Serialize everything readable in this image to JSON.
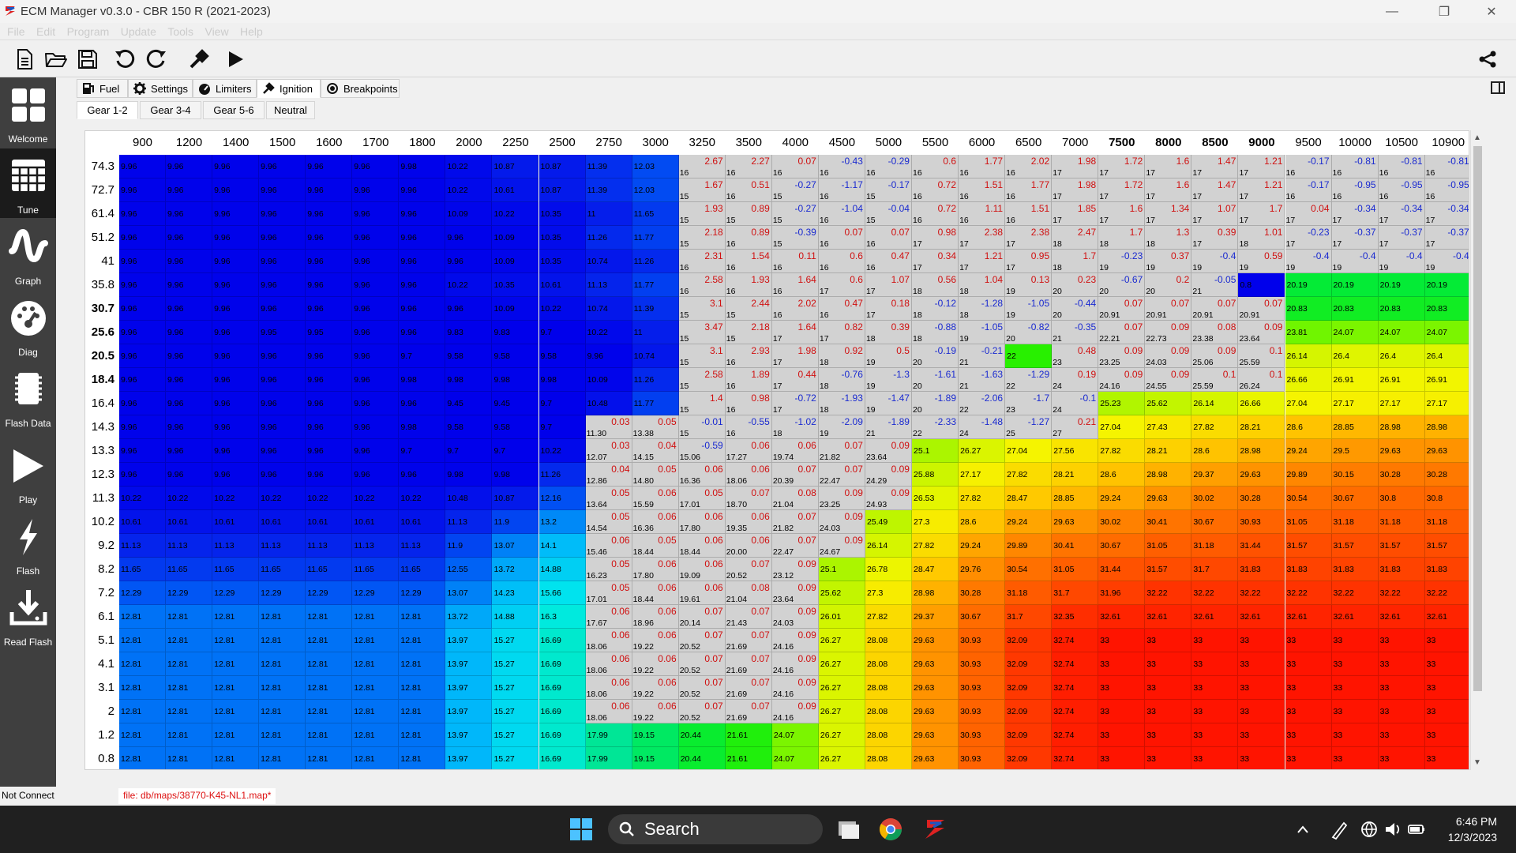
{
  "window": {
    "title": "ECM Manager v0.3.0 - CBR 150 R   (2021-2023)"
  },
  "menu": [
    "File",
    "Edit",
    "Program",
    "Update",
    "Tools",
    "View",
    "Help"
  ],
  "toolbar": [
    "new-file-icon",
    "open-folder-icon",
    "save-icon",
    "undo-icon",
    "redo-icon",
    "tools-icon",
    "run-icon"
  ],
  "sidebar": [
    {
      "label": "Welcome",
      "icon": "welcome-icon"
    },
    {
      "label": "Tune",
      "icon": "tune-grid-icon"
    },
    {
      "label": "Graph",
      "icon": "graph-icon"
    },
    {
      "label": "Diag",
      "icon": "diag-gauge-icon"
    },
    {
      "label": "Flash Data",
      "icon": "flash-data-icon"
    },
    {
      "label": "Play",
      "icon": "play-icon"
    },
    {
      "label": "Flash",
      "icon": "flash-bolt-icon"
    },
    {
      "label": "Read Flash",
      "icon": "read-flash-icon"
    }
  ],
  "tabs": [
    {
      "label": "Fuel",
      "icon": "fuel-icon"
    },
    {
      "label": "Settings",
      "icon": "settings-gear-icon"
    },
    {
      "label": "Limiters",
      "icon": "limiter-gauge-icon"
    },
    {
      "label": "Ignition",
      "icon": "ignition-icon"
    },
    {
      "label": "Breakpoints",
      "icon": "breakpoints-icon"
    }
  ],
  "subtabs": [
    "Gear 1-2",
    "Gear 3-4",
    "Gear 5-6",
    "Neutral"
  ],
  "table": {
    "columns": [
      "900",
      "1200",
      "1400",
      "1500",
      "1600",
      "1700",
      "1800",
      "2000",
      "2250",
      "2500",
      "2750",
      "3000",
      "3250",
      "3500",
      "4000",
      "4500",
      "5000",
      "5500",
      "6000",
      "6500",
      "7000",
      "7500",
      "8000",
      "8500",
      "9000",
      "9500",
      "10000",
      "10500",
      "10900"
    ],
    "bold_columns": [
      "7500",
      "8000",
      "8500",
      "9000"
    ],
    "rows": [
      "74.3",
      "72.7",
      "61.4",
      "51.2",
      "41",
      "35.8",
      "30.7",
      "25.6",
      "20.5",
      "18.4",
      "16.4",
      "14.3",
      "13.3",
      "12.3",
      "11.3",
      "10.2",
      "9.2",
      "8.2",
      "7.2",
      "6.1",
      "5.1",
      "4.1",
      "3.1",
      "2",
      "1.2",
      "0.8"
    ],
    "bold_rows": [
      "30.7",
      "25.6",
      "20.5",
      "18.4"
    ],
    "cells": [
      [
        "9.96",
        "9.96",
        "9.96",
        "9.96",
        "9.96",
        "9.96",
        "9.98",
        "10.22",
        "10.87",
        "10.87",
        "11.39",
        "12.03",
        "2.67|16",
        "2.27|16",
        "0.07|16",
        "-0.43|16",
        "-0.29|16",
        "0.6|16",
        "1.77|16",
        "2.02|16",
        "1.98|17",
        "1.72|17",
        "1.6|17",
        "1.47|17",
        "1.21|17",
        "-0.17|16",
        "-0.81|16",
        "-0.81|16",
        "-0.81|16"
      ],
      [
        "9.96",
        "9.96",
        "9.96",
        "9.96",
        "9.96",
        "9.96",
        "9.96",
        "10.22",
        "10.61",
        "10.87",
        "11.39",
        "12.03",
        "1.67|15",
        "0.51|16",
        "-0.27|15",
        "-1.17|16",
        "-0.17|15",
        "0.72|16",
        "1.51|16",
        "1.77|16",
        "1.98|17",
        "1.72|17",
        "1.6|17",
        "1.47|17",
        "1.21|17",
        "-0.17|16",
        "-0.95|16",
        "-0.95|16",
        "-0.95|16"
      ],
      [
        "9.96",
        "9.96",
        "9.96",
        "9.96",
        "9.96",
        "9.96",
        "9.96",
        "10.09",
        "10.22",
        "10.35",
        "11",
        "11.65",
        "1.93|15",
        "0.89|15",
        "-0.27|15",
        "-1.04|16",
        "-0.04|15",
        "0.72|16",
        "1.11|16",
        "1.51|16",
        "1.85|17",
        "1.6|17",
        "1.34|17",
        "1.07|17",
        "1.7|17",
        "0.04|17",
        "-0.34|17",
        "-0.34|17",
        "-0.34|17"
      ],
      [
        "9.96",
        "9.96",
        "9.96",
        "9.96",
        "9.96",
        "9.96",
        "9.96",
        "9.96",
        "10.09",
        "10.35",
        "11.26",
        "11.77",
        "2.18|15",
        "0.89|16",
        "-0.39|15",
        "0.07|16",
        "0.07|16",
        "0.98|17",
        "2.38|17",
        "2.38|17",
        "2.47|18",
        "1.7|18",
        "1.3|18",
        "0.39|17",
        "1.01|18",
        "-0.23|17",
        "-0.37|17",
        "-0.37|17",
        "-0.37|17"
      ],
      [
        "9.96",
        "9.96",
        "9.96",
        "9.96",
        "9.96",
        "9.96",
        "9.96",
        "9.96",
        "10.09",
        "10.35",
        "10.74",
        "11.26",
        "2.31|16",
        "1.54|16",
        "0.11|16",
        "0.6|16",
        "0.47|16",
        "0.34|17",
        "1.21|17",
        "0.95|17",
        "1.7|18",
        "-0.23|19",
        "0.37|19",
        "-0.4|19",
        "0.59|19",
        "-0.4|19",
        "-0.4|19",
        "-0.4|19",
        "-0.4|19"
      ],
      [
        "9.96",
        "9.96",
        "9.96",
        "9.96",
        "9.96",
        "9.96",
        "9.96",
        "9.96",
        "10.22",
        "10.35",
        "10.61",
        "11.13",
        "11.77",
        "2.58|16",
        "1.93|16",
        "1.64|16",
        "0.6|17",
        "1.07|17",
        "0.56|18",
        "1.04|18",
        "0.13|19",
        "0.23|20",
        "-0.67|20",
        "0.2|20",
        "-0.05|21",
        "0.8",
        "20.19",
        "20.19",
        "20.19",
        "20.19"
      ],
      [
        "9.96",
        "9.96",
        "9.96",
        "9.96",
        "9.96",
        "9.96",
        "9.96",
        "9.96",
        "9.96",
        "10.09",
        "10.22",
        "10.74",
        "11.39",
        "3.1|15",
        "2.44|15",
        "2.02|16",
        "0.47|16",
        "0.18|17",
        "-0.12|18",
        "-1.28|18",
        "-1.05|19",
        "-0.44|20",
        "0.07|20.91",
        "0.07|20.91",
        "0.07|20.91",
        "0.07|20.91",
        "20.83",
        "20.83",
        "20.83",
        "20.83"
      ],
      [
        "9.96",
        "9.96",
        "9.96",
        "9.96",
        "9.95",
        "9.95",
        "9.96",
        "9.96",
        "9.83",
        "9.83",
        "9.7",
        "10.22",
        "11",
        "3.47|15",
        "2.18|15",
        "1.64|17",
        "0.82|17",
        "0.39|18",
        "-0.88|18",
        "-1.05|19",
        "-0.82|20",
        "-0.35|21",
        "0.07|22.21",
        "0.09|22.73",
        "0.08|23.38",
        "0.09|23.64",
        "23.81",
        "24.07",
        "24.07",
        "24.07"
      ],
      [
        "9.96",
        "9.96",
        "9.96",
        "9.96",
        "9.96",
        "9.96",
        "9.7",
        "9.58",
        "9.58",
        "9.58",
        "9.96",
        "10.74",
        "3.1|15",
        "2.93|16",
        "1.98|17",
        "0.92|18",
        "0.5|19",
        "-0.19|20",
        "-0.21|21",
        "22",
        "0.48|23",
        "0.09|23.25",
        "0.09|24.03",
        "0.09|25.06",
        "0.1|25.59",
        "26.14",
        "26.4",
        "26.4",
        "26.4"
      ],
      [
        "9.96",
        "9.96",
        "9.96",
        "9.96",
        "9.96",
        "9.96",
        "9.98",
        "9.98",
        "9.98",
        "9.98",
        "10.09",
        "11.26",
        "2.58|15",
        "1.89|16",
        "0.44|17",
        "-0.76|18",
        "-1.3|19",
        "-1.61|20",
        "-1.63|21",
        "-1.29|22",
        "0.19|24",
        "0.09|24.16",
        "0.09|24.55",
        "0.1|25.59",
        "0.1|26.24",
        "26.66",
        "26.91",
        "26.91",
        "26.91"
      ],
      [
        "9.96",
        "9.96",
        "9.96",
        "9.96",
        "9.96",
        "9.96",
        "9.96",
        "9.45",
        "9.45",
        "9.7",
        "10.48",
        "11.77",
        "1.4|15",
        "0.98|16",
        "-0.72|17",
        "-1.93|18",
        "-1.47|19",
        "-1.89|20",
        "-2.06|22",
        "-1.7|23",
        "-0.1|24",
        "25.23",
        "25.62",
        "26.14",
        "26.66",
        "27.04",
        "27.17",
        "27.17",
        "27.17"
      ],
      [
        "9.96",
        "9.96",
        "9.96",
        "9.96",
        "9.96",
        "9.96",
        "9.98",
        "9.58",
        "9.58",
        "9.7",
        "0.03|11.30",
        "0.05|13.38",
        "-0.01|15",
        "-0.55|16",
        "-1.02|18",
        "-2.09|19",
        "-1.89|21",
        "-2.33|22",
        "-1.48|24",
        "-1.27|25",
        "0.21|27",
        "27.04",
        "27.43",
        "27.82",
        "28.21",
        "28.6",
        "28.85",
        "28.98",
        "28.98"
      ],
      [
        "9.96",
        "9.96",
        "9.96",
        "9.96",
        "9.96",
        "9.96",
        "9.7",
        "9.7",
        "9.7",
        "10.22",
        "0.03|12.07",
        "0.04|14.15",
        "-0.59|15.06",
        "0.06|17.27",
        "0.06|19.74",
        "0.07|21.82",
        "0.09|23.64",
        "25.1",
        "26.27",
        "27.04",
        "27.56",
        "27.82",
        "28.21",
        "28.6",
        "28.98",
        "29.24",
        "29.5",
        "29.63",
        "29.63"
      ],
      [
        "9.96",
        "9.96",
        "9.96",
        "9.96",
        "9.96",
        "9.96",
        "9.96",
        "9.98",
        "9.98",
        "11.26",
        "0.04|12.86",
        "0.05|14.80",
        "0.06|16.36",
        "0.06|18.06",
        "0.07|20.39",
        "0.07|22.47",
        "0.09|24.29",
        "25.88",
        "27.17",
        "27.82",
        "28.21",
        "28.6",
        "28.98",
        "29.37",
        "29.63",
        "29.89",
        "30.15",
        "30.28",
        "30.28"
      ],
      [
        "10.22",
        "10.22",
        "10.22",
        "10.22",
        "10.22",
        "10.22",
        "10.22",
        "10.48",
        "10.87",
        "12.16",
        "0.05|13.64",
        "0.06|15.59",
        "0.05|17.01",
        "0.07|18.70",
        "0.08|21.04",
        "0.09|23.25",
        "0.09|24.93",
        "26.53",
        "27.82",
        "28.47",
        "28.85",
        "29.24",
        "29.63",
        "30.02",
        "30.28",
        "30.54",
        "30.67",
        "30.8",
        "30.8"
      ],
      [
        "10.61",
        "10.61",
        "10.61",
        "10.61",
        "10.61",
        "10.61",
        "10.61",
        "11.13",
        "11.9",
        "13.2",
        "0.05|14.54",
        "0.06|16.36",
        "0.06|17.80",
        "0.06|19.35",
        "0.07|21.82",
        "0.09|24.03",
        "25.49",
        "27.3",
        "28.6",
        "29.24",
        "29.63",
        "30.02",
        "30.41",
        "30.67",
        "30.93",
        "31.05",
        "31.18",
        "31.18",
        "31.18"
      ],
      [
        "11.13",
        "11.13",
        "11.13",
        "11.13",
        "11.13",
        "11.13",
        "11.13",
        "11.9",
        "13.07",
        "14.1",
        "0.06|15.46",
        "0.05|18.44",
        "0.06|18.44",
        "0.06|20.00",
        "0.07|22.47",
        "0.09|24.67",
        "26.14",
        "27.82",
        "29.24",
        "29.89",
        "30.41",
        "30.67",
        "31.05",
        "31.18",
        "31.44",
        "31.57",
        "31.57",
        "31.57",
        "31.57"
      ],
      [
        "11.65",
        "11.65",
        "11.65",
        "11.65",
        "11.65",
        "11.65",
        "11.65",
        "12.55",
        "13.72",
        "14.88",
        "0.05|16.23",
        "0.06|17.80",
        "0.06|19.09",
        "0.07|20.52",
        "0.09|23.12",
        "25.1",
        "26.78",
        "28.47",
        "29.76",
        "30.54",
        "31.05",
        "31.44",
        "31.57",
        "31.7",
        "31.83",
        "31.83",
        "31.83",
        "31.83",
        "31.83"
      ],
      [
        "12.29",
        "12.29",
        "12.29",
        "12.29",
        "12.29",
        "12.29",
        "12.29",
        "13.07",
        "14.23",
        "15.66",
        "0.05|17.01",
        "0.06|18.44",
        "0.06|19.61",
        "0.08|21.04",
        "0.09|23.64",
        "25.62",
        "27.3",
        "28.98",
        "30.28",
        "31.18",
        "31.7",
        "31.96",
        "32.22",
        "32.22",
        "32.22",
        "32.22",
        "32.22",
        "32.22",
        "32.22"
      ],
      [
        "12.81",
        "12.81",
        "12.81",
        "12.81",
        "12.81",
        "12.81",
        "12.81",
        "13.72",
        "14.88",
        "16.3",
        "0.06|17.67",
        "0.06|18.96",
        "0.07|20.14",
        "0.07|21.43",
        "0.09|24.03",
        "26.01",
        "27.82",
        "29.37",
        "30.67",
        "31.7",
        "32.35",
        "32.61",
        "32.61",
        "32.61",
        "32.61",
        "32.61",
        "32.61",
        "32.61",
        "32.61"
      ],
      [
        "12.81",
        "12.81",
        "12.81",
        "12.81",
        "12.81",
        "12.81",
        "12.81",
        "13.97",
        "15.27",
        "16.69",
        "0.06|18.06",
        "0.06|19.22",
        "0.07|20.52",
        "0.07|21.69",
        "0.09|24.16",
        "26.27",
        "28.08",
        "29.63",
        "30.93",
        "32.09",
        "32.74",
        "33",
        "33",
        "33",
        "33",
        "33",
        "33",
        "33",
        "33"
      ],
      [
        "12.81",
        "12.81",
        "12.81",
        "12.81",
        "12.81",
        "12.81",
        "12.81",
        "13.97",
        "15.27",
        "16.69",
        "0.06|18.06",
        "0.06|19.22",
        "0.07|20.52",
        "0.07|21.69",
        "0.09|24.16",
        "26.27",
        "28.08",
        "29.63",
        "30.93",
        "32.09",
        "32.74",
        "33",
        "33",
        "33",
        "33",
        "33",
        "33",
        "33",
        "33"
      ],
      [
        "12.81",
        "12.81",
        "12.81",
        "12.81",
        "12.81",
        "12.81",
        "12.81",
        "13.97",
        "15.27",
        "16.69",
        "0.06|18.06",
        "0.06|19.22",
        "0.07|20.52",
        "0.07|21.69",
        "0.09|24.16",
        "26.27",
        "28.08",
        "29.63",
        "30.93",
        "32.09",
        "32.74",
        "33",
        "33",
        "33",
        "33",
        "33",
        "33",
        "33",
        "33"
      ],
      [
        "12.81",
        "12.81",
        "12.81",
        "12.81",
        "12.81",
        "12.81",
        "12.81",
        "13.97",
        "15.27",
        "16.69",
        "0.06|18.06",
        "0.06|19.22",
        "0.07|20.52",
        "0.07|21.69",
        "0.09|24.16",
        "26.27",
        "28.08",
        "29.63",
        "30.93",
        "32.09",
        "32.74",
        "33",
        "33",
        "33",
        "33",
        "33",
        "33",
        "33",
        "33"
      ],
      [
        "12.81",
        "12.81",
        "12.81",
        "12.81",
        "12.81",
        "12.81",
        "12.81",
        "13.97",
        "15.27",
        "16.69",
        "17.99",
        "19.15",
        "20.44",
        "21.61",
        "24.07",
        "26.27",
        "28.08",
        "29.63",
        "30.93",
        "32.09",
        "32.74",
        "33",
        "33",
        "33",
        "33",
        "33",
        "33",
        "33",
        "33"
      ],
      [
        "12.81",
        "12.81",
        "12.81",
        "12.81",
        "12.81",
        "12.81",
        "12.81",
        "13.97",
        "15.27",
        "16.69",
        "17.99",
        "19.15",
        "20.44",
        "21.61",
        "24.07",
        "26.27",
        "28.08",
        "29.63",
        "30.93",
        "32.09",
        "32.74",
        "33",
        "33",
        "33",
        "33",
        "33",
        "33",
        "33",
        "33"
      ]
    ]
  },
  "status": {
    "connection": "Not Connect",
    "file": "file: db/maps/38770-K45-NL1.map*"
  },
  "taskbar": {
    "search": "Search",
    "time": "6:46 PM",
    "date": "12/3/2023"
  }
}
